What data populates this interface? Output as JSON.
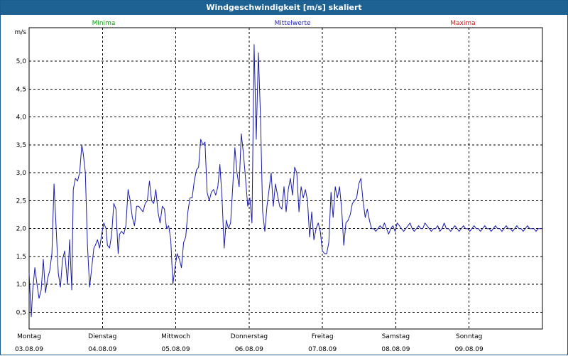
{
  "window": {
    "title": "Windgeschwindigkeit [m/s] skaliert"
  },
  "colors": {
    "titlebar": "#1e6193",
    "minima": "#11a311",
    "mittelwerte": "#2222cc",
    "maxima": "#c81e1e",
    "series": "#1a1aa8",
    "grid": "#000000"
  },
  "legend": {
    "minima": "Minima",
    "mittelwerte": "Mittelwerte",
    "maxima": "Maxima"
  },
  "chart_data": {
    "type": "line",
    "title": "Windgeschwindigkeit [m/s] skaliert",
    "ylabel": "m/s",
    "ylim": [
      0.2,
      5.6
    ],
    "yticks": [
      "0.5",
      "1.0",
      "1.5",
      "2.0",
      "2.5",
      "3.0",
      "3.5",
      "4.0",
      "4.5",
      "5.0"
    ],
    "ytick_labels": [
      "0,5",
      "1,0",
      "1,5",
      "2,0",
      "2,5",
      "3,0",
      "3,5",
      "4,0",
      "4,5",
      "5,0"
    ],
    "xlim": [
      0,
      7
    ],
    "x_ticks": [
      {
        "day": "Montag",
        "date": "03.08.09"
      },
      {
        "day": "Dienstag",
        "date": "04.08.09"
      },
      {
        "day": "Mittwoch",
        "date": "05.08.09"
      },
      {
        "day": "Donnerstag",
        "date": "06.08.09"
      },
      {
        "day": "Freitag",
        "date": "07.08.09"
      },
      {
        "day": "Samstag",
        "date": "08.08.09"
      },
      {
        "day": "Sonntag",
        "date": "09.08.09"
      }
    ],
    "grid": true,
    "series": [
      {
        "name": "Mittelwerte",
        "x": [
          0,
          0.029,
          0.049,
          0.078,
          0.107,
          0.136,
          0.165,
          0.194,
          0.223,
          0.252,
          0.282,
          0.311,
          0.34,
          0.369,
          0.398,
          0.427,
          0.456,
          0.485,
          0.524,
          0.553,
          0.582,
          0.602,
          0.631,
          0.66,
          0.689,
          0.718,
          0.738,
          0.767,
          0.796,
          0.825,
          0.854,
          0.883,
          0.903,
          0.932,
          0.961,
          0.99,
          1.019,
          1.049,
          1.068,
          1.097,
          1.126,
          1.155,
          1.184,
          1.214,
          1.233,
          1.262,
          1.291,
          1.32,
          1.35,
          1.379,
          1.408,
          1.437,
          1.466,
          1.495,
          1.524,
          1.553,
          1.583,
          1.612,
          1.641,
          1.67,
          1.699,
          1.728,
          1.757,
          1.786,
          1.816,
          1.845,
          1.874,
          1.903,
          1.932,
          1.961,
          1.99,
          2.019,
          2.049,
          2.078,
          2.107,
          2.136,
          2.165,
          2.194,
          2.223,
          2.252,
          2.282,
          2.311,
          2.34,
          2.369,
          2.398,
          2.427,
          2.456,
          2.485,
          2.515,
          2.544,
          2.573,
          2.602,
          2.631,
          2.66,
          2.689,
          2.718,
          2.748,
          2.777,
          2.806,
          2.835,
          2.864,
          2.893,
          2.922,
          2.951,
          2.981,
          3.01,
          3.039,
          3.068,
          3.097,
          3.126,
          3.155,
          3.184,
          3.214,
          3.243,
          3.272,
          3.301,
          3.33,
          3.359,
          3.388,
          3.417,
          3.447,
          3.476,
          3.505,
          3.534,
          3.563,
          3.592,
          3.621,
          3.65,
          3.68,
          3.709,
          3.738,
          3.767,
          3.796,
          3.825,
          3.854,
          3.883,
          3.913,
          3.942,
          3.971,
          4.0,
          4.029,
          4.058,
          4.087,
          4.117,
          4.146,
          4.175,
          4.204,
          4.233,
          4.262,
          4.291,
          4.32,
          4.35,
          4.379,
          4.408,
          4.437,
          4.466,
          4.495,
          4.524,
          4.553,
          4.583,
          4.612,
          4.641,
          4.67,
          4.699,
          4.728,
          4.757,
          4.786,
          4.816,
          4.845,
          4.874,
          4.903,
          4.932,
          4.961,
          4.99,
          5.019,
          5.049,
          5.078,
          5.107,
          5.136,
          5.165,
          5.194,
          5.223,
          5.252,
          5.282,
          5.311,
          5.34,
          5.369,
          5.398,
          5.427,
          5.456,
          5.485,
          5.515,
          5.544,
          5.573,
          5.602,
          5.631,
          5.66,
          5.689,
          5.718,
          5.748,
          5.777,
          5.806,
          5.835,
          5.864,
          5.893,
          5.922,
          5.951,
          5.981,
          6.01,
          6.039,
          6.068,
          6.097,
          6.126,
          6.155,
          6.184,
          6.214,
          6.243,
          6.272,
          6.301,
          6.33,
          6.359,
          6.388,
          6.417,
          6.447,
          6.476,
          6.505,
          6.534,
          6.563,
          6.592,
          6.621,
          6.65,
          6.68,
          6.709,
          6.738,
          6.767,
          6.796,
          6.825,
          6.854,
          6.883,
          6.913,
          6.942,
          6.971,
          7.0
        ],
        "y": [
          1.2,
          0.42,
          0.9,
          1.3,
          1.0,
          0.75,
          0.9,
          1.45,
          0.85,
          1.1,
          1.25,
          1.55,
          2.8,
          2.0,
          1.2,
          0.95,
          1.45,
          1.6,
          1.0,
          1.8,
          0.9,
          2.7,
          2.9,
          2.85,
          3.0,
          3.5,
          3.35,
          3.0,
          1.7,
          0.95,
          1.3,
          1.65,
          1.7,
          1.8,
          1.65,
          1.9,
          2.1,
          2.0,
          1.7,
          1.65,
          1.9,
          2.45,
          2.35,
          1.55,
          1.9,
          1.95,
          1.9,
          2.05,
          2.7,
          2.5,
          2.2,
          2.05,
          2.4,
          2.4,
          2.35,
          2.3,
          2.45,
          2.5,
          2.85,
          2.5,
          2.45,
          2.7,
          2.3,
          2.1,
          2.4,
          2.35,
          2.0,
          2.05,
          1.8,
          1.0,
          1.3,
          1.55,
          1.45,
          1.3,
          1.75,
          1.85,
          2.3,
          2.55,
          2.55,
          2.85,
          3.05,
          3.1,
          3.6,
          3.5,
          3.55,
          2.65,
          2.5,
          2.65,
          2.7,
          2.6,
          2.75,
          3.15,
          2.55,
          1.65,
          2.15,
          2.0,
          2.1,
          2.75,
          3.45,
          3.0,
          2.75,
          3.7,
          3.35,
          2.9,
          2.4,
          2.55,
          2.1,
          5.3,
          3.6,
          5.15,
          4.0,
          2.3,
          1.95,
          2.4,
          2.7,
          3.0,
          2.4,
          2.8,
          2.6,
          2.4,
          2.35,
          2.75,
          2.3,
          2.7,
          2.9,
          2.6,
          3.1,
          3.0,
          2.3,
          2.75,
          2.55,
          2.7,
          2.5,
          1.85,
          2.3,
          1.8,
          2.0,
          2.1,
          1.95,
          1.6,
          1.55,
          1.55,
          1.75,
          2.65,
          2.2,
          2.75,
          2.55,
          2.75,
          2.35,
          1.7,
          2.1,
          2.15,
          2.25,
          2.45,
          2.5,
          2.55,
          2.8,
          2.9,
          2.5,
          2.2,
          2.35,
          2.15,
          2.0,
          2.0,
          1.95,
          2.0,
          2.05,
          2.0,
          2.1,
          2.0,
          1.9,
          2.0,
          2.05,
          1.95,
          2.1,
          2.05,
          2.0,
          1.95,
          2.0,
          2.05,
          2.1,
          2.0,
          1.95,
          2.0,
          2.05,
          2.0,
          2.0,
          2.1,
          2.05,
          2.0,
          1.95,
          2.0,
          2.0,
          2.05,
          1.95,
          2.0,
          2.1,
          2.0,
          2.0,
          1.95,
          2.0,
          2.05,
          2.0,
          1.95,
          2.0,
          2.05,
          2.0,
          2.0,
          1.95,
          2.0,
          2.05,
          2.0,
          2.0,
          1.95,
          2.0,
          2.05,
          2.0,
          2.0,
          1.95,
          2.0,
          2.05,
          2.0,
          2.0,
          1.95,
          2.0,
          2.05,
          2.0,
          2.0,
          1.95,
          2.0,
          2.05,
          2.0,
          2.0,
          1.95,
          2.0,
          2.05,
          2.0,
          2.0,
          2.0,
          1.95,
          2.0,
          2.0,
          2.0
        ]
      }
    ]
  }
}
